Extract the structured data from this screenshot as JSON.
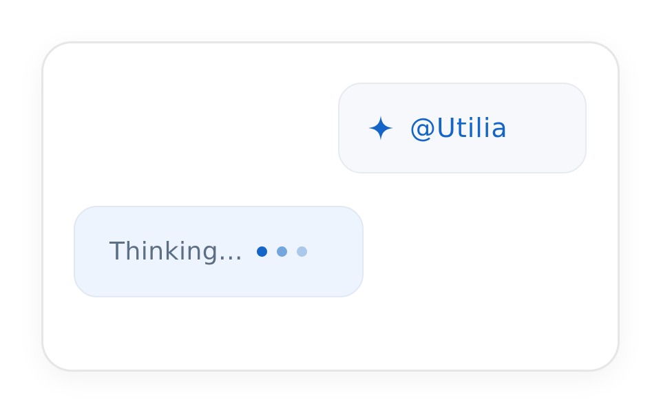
{
  "chat": {
    "user_message": {
      "icon": "sparkle-icon",
      "text": "@Utilia"
    },
    "assistant_status": {
      "text": "Thinking...",
      "loading_dots": 3
    }
  },
  "colors": {
    "accent": "#1565c9",
    "dot_1": "#1565c9",
    "dot_2": "#74a6de",
    "dot_3": "#a9c8ea",
    "status_text": "#5d6f85",
    "user_bubble_bg": "#f6f8fb",
    "assistant_bubble_bg": "#eef4fd"
  }
}
